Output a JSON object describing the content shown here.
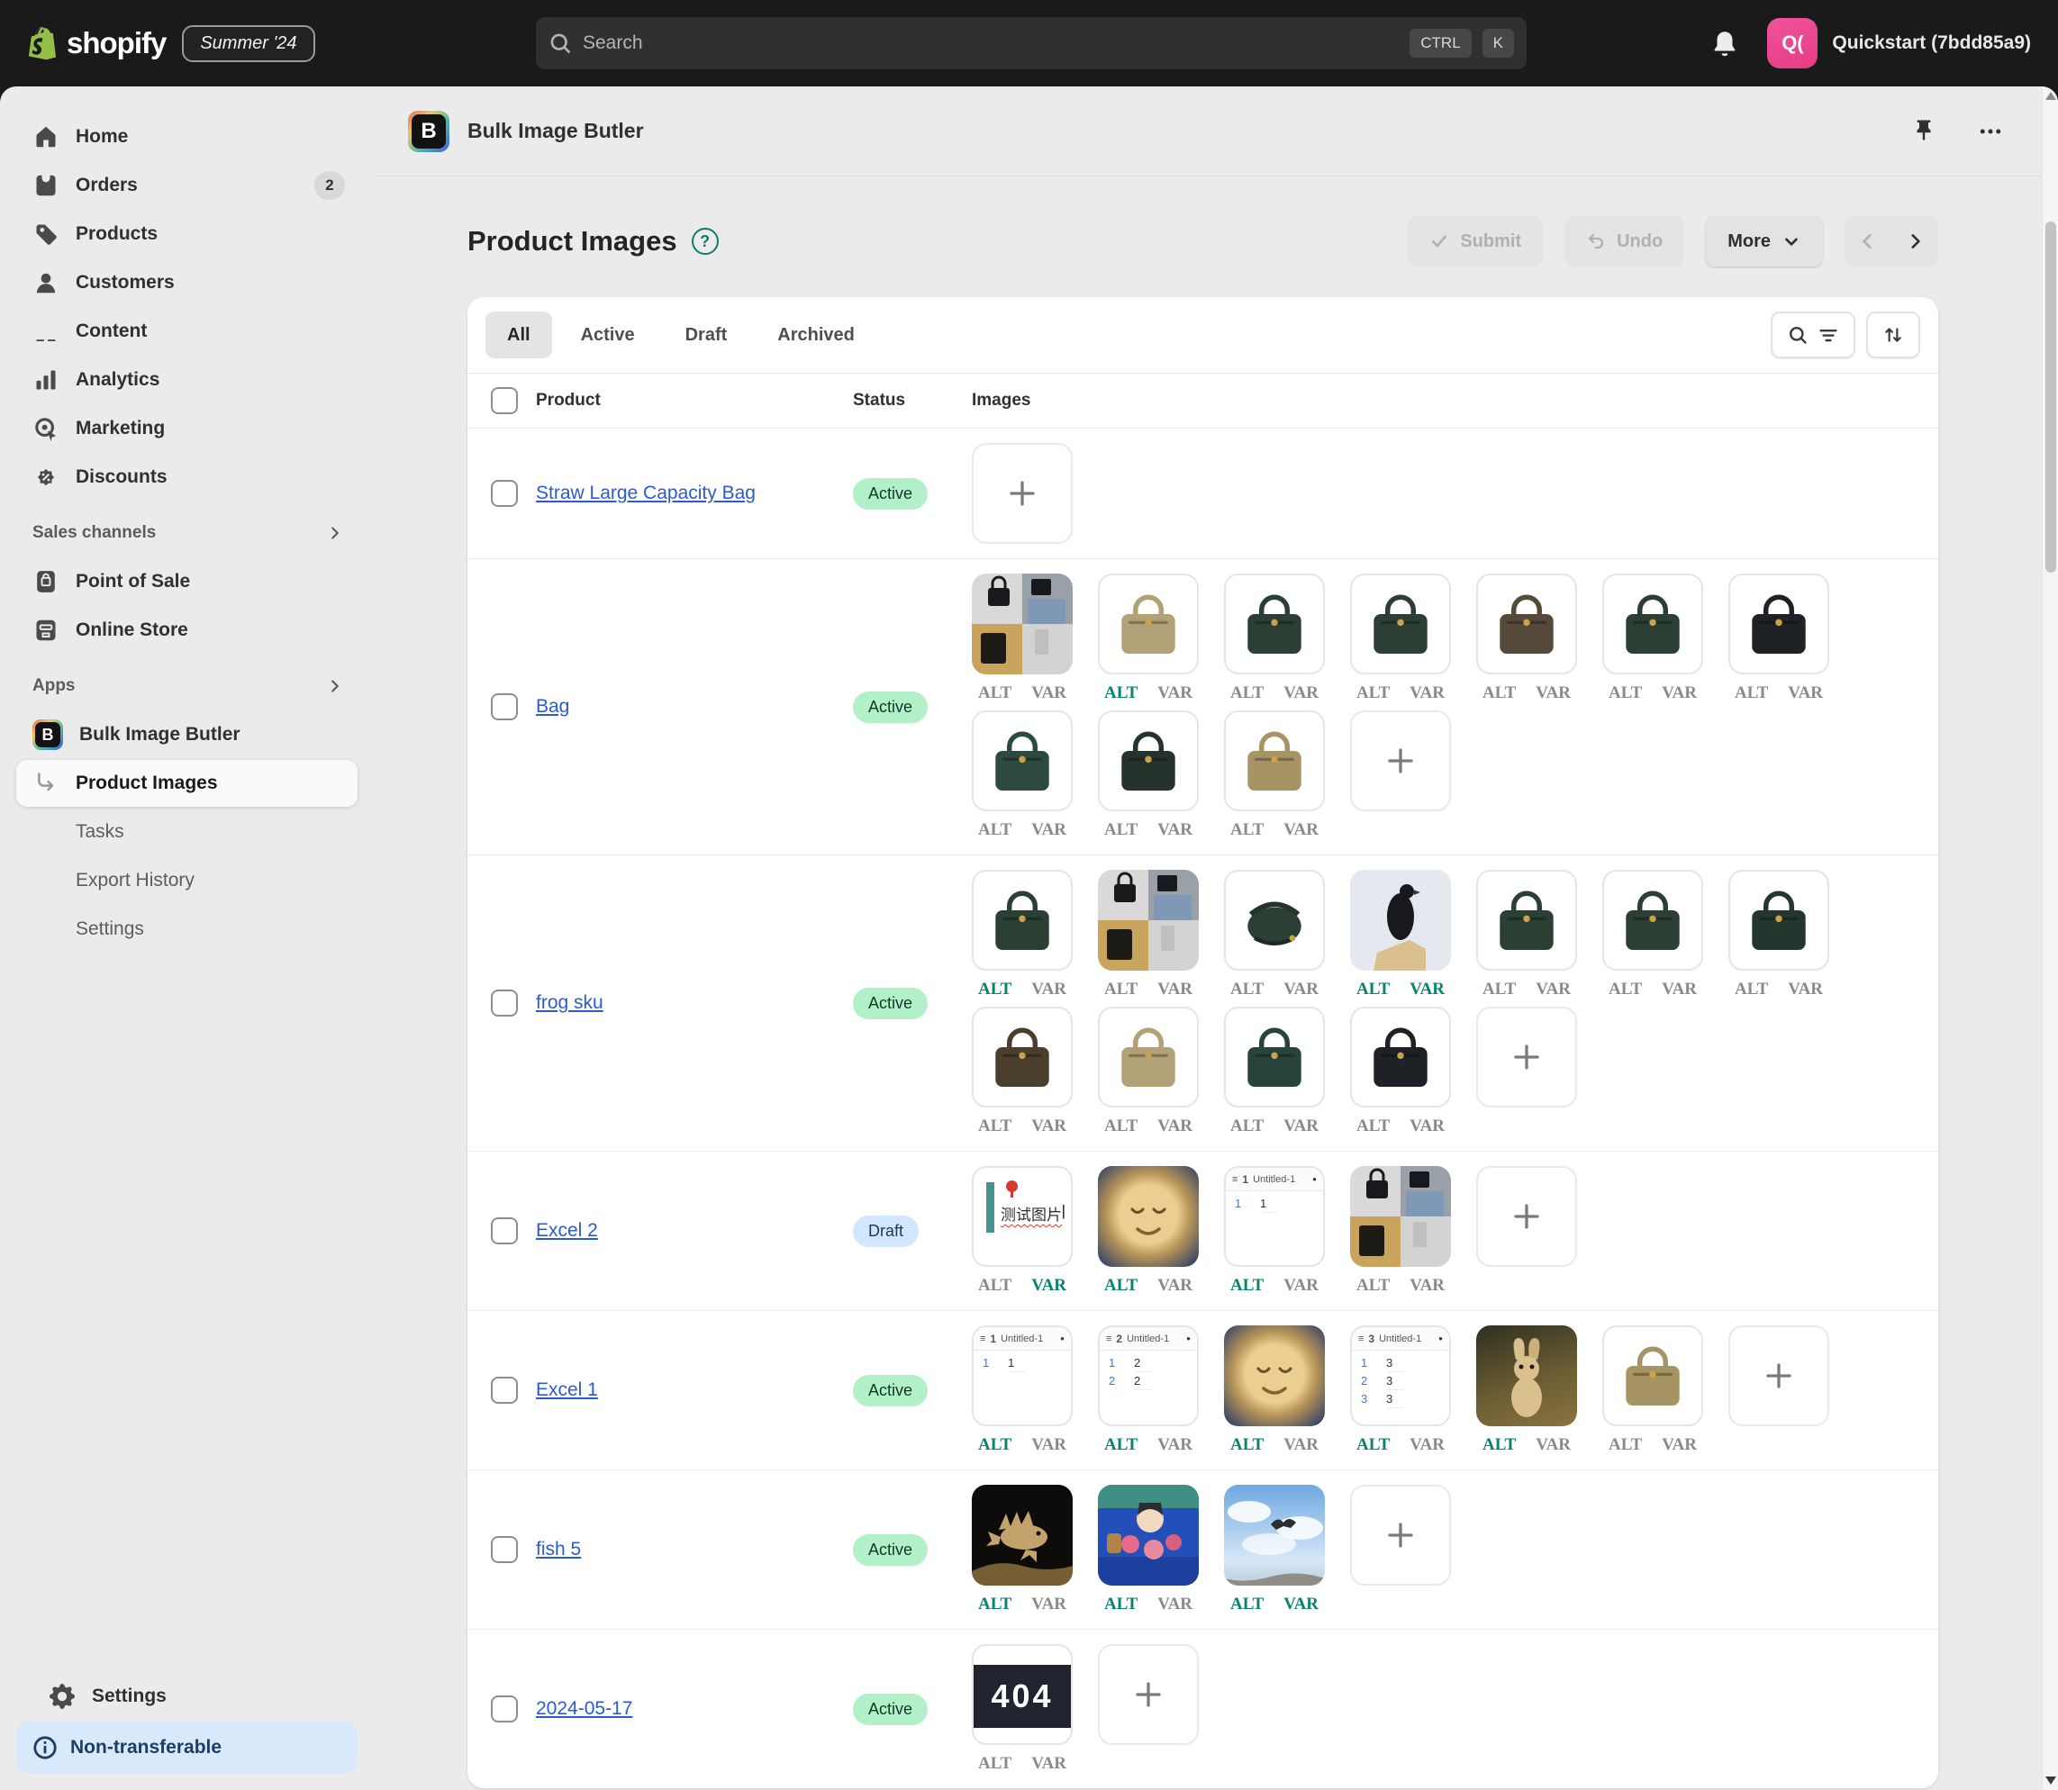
{
  "topbar": {
    "logo_text": "shopify",
    "version_badge": "Summer '24",
    "search_placeholder": "Search",
    "shortcut_keys": [
      "CTRL",
      "K"
    ],
    "user": {
      "initials": "Q(",
      "name": "Quickstart (7bdd85a9)"
    }
  },
  "sidebar": {
    "items": [
      {
        "label": "Home",
        "icon": "home"
      },
      {
        "label": "Orders",
        "icon": "orders",
        "badge": "2"
      },
      {
        "label": "Products",
        "icon": "tag"
      },
      {
        "label": "Customers",
        "icon": "person"
      },
      {
        "label": "Content",
        "icon": "picture"
      },
      {
        "label": "Analytics",
        "icon": "bars"
      },
      {
        "label": "Marketing",
        "icon": "target"
      },
      {
        "label": "Discounts",
        "icon": "discount"
      }
    ],
    "sections": [
      {
        "title": "Sales channels",
        "items": [
          {
            "label": "Point of Sale",
            "icon": "pos"
          },
          {
            "label": "Online Store",
            "icon": "store"
          }
        ]
      },
      {
        "title": "Apps",
        "items": [
          {
            "label": "Bulk Image Butler",
            "icon": "app-b"
          },
          {
            "label": "Product Images",
            "icon": "elbow",
            "active": true
          },
          {
            "label": "Tasks",
            "sub": true
          },
          {
            "label": "Export History",
            "sub": true
          },
          {
            "label": "Settings",
            "sub": true
          }
        ]
      }
    ],
    "footer": {
      "settings_label": "Settings",
      "notice": "Non-transferable"
    }
  },
  "app_header": {
    "title": "Bulk Image Butler",
    "icon_letter": "B"
  },
  "page": {
    "title": "Product Images",
    "help_glyph": "?",
    "submit_label": "Submit",
    "undo_label": "Undo",
    "more_label": "More"
  },
  "tabs": [
    {
      "label": "All",
      "active": true
    },
    {
      "label": "Active"
    },
    {
      "label": "Draft"
    },
    {
      "label": "Archived"
    }
  ],
  "table": {
    "columns": [
      "Product",
      "Status",
      "Images"
    ],
    "alt_label": "ALT",
    "var_label": "VAR",
    "sheet_title": "Untitled-1",
    "doc_text": "测试图片",
    "not_found_text": "404",
    "colors": {
      "label_active": "#0a8270",
      "label_inactive": "#8a8a8a",
      "link": "#2a5bd0",
      "badge_success_bg": "#b2f1c8",
      "badge_info_bg": "#d2e7fd"
    },
    "rows": [
      {
        "product": "Straw Large Capacity Bag",
        "status": "Active",
        "status_type": "success",
        "lines": [
          [
            {
              "kind": "add"
            }
          ]
        ]
      },
      {
        "product": "Bag",
        "status": "Active",
        "status_type": "success",
        "lines": [
          [
            {
              "kind": "collage",
              "alt": 0,
              "var": 0
            },
            {
              "kind": "bag",
              "color": "#b2a177",
              "alt": 1,
              "var": 0
            },
            {
              "kind": "bag",
              "color": "#2c3f35",
              "alt": 0,
              "var": 0
            },
            {
              "kind": "bag",
              "color": "#2c3f35",
              "alt": 0,
              "var": 0
            },
            {
              "kind": "bag",
              "color": "#55493a",
              "alt": 0,
              "var": 0
            },
            {
              "kind": "bag",
              "color": "#2c3f35",
              "alt": 0,
              "var": 0
            },
            {
              "kind": "bag",
              "color": "#1e2126",
              "alt": 0,
              "var": 0
            }
          ],
          [
            {
              "kind": "bag",
              "color": "#2c4a3e",
              "alt": 0,
              "var": 0
            },
            {
              "kind": "bag",
              "color": "#26332c",
              "alt": 0,
              "var": 0
            },
            {
              "kind": "bag",
              "color": "#a79464",
              "alt": 0,
              "var": 0
            },
            {
              "kind": "add"
            }
          ]
        ]
      },
      {
        "product": "frog sku",
        "status": "Active",
        "status_type": "success",
        "lines": [
          [
            {
              "kind": "bag",
              "color": "#2c3f35",
              "alt": 1,
              "var": 0
            },
            {
              "kind": "collage",
              "alt": 0,
              "var": 0
            },
            {
              "kind": "bagtop",
              "alt": 0,
              "var": 0
            },
            {
              "kind": "pigeon",
              "alt": 1,
              "var": 1
            },
            {
              "kind": "bag",
              "color": "#2c3f35",
              "alt": 0,
              "var": 0
            },
            {
              "kind": "bag",
              "color": "#2c3f35",
              "alt": 0,
              "var": 0
            },
            {
              "kind": "bag",
              "color": "#24372f",
              "alt": 0,
              "var": 0
            }
          ],
          [
            {
              "kind": "bag",
              "color": "#4a3e2d",
              "alt": 0,
              "var": 0
            },
            {
              "kind": "bag",
              "color": "#b2a177",
              "alt": 0,
              "var": 0
            },
            {
              "kind": "bag",
              "color": "#28443a",
              "alt": 0,
              "var": 0
            },
            {
              "kind": "bag",
              "color": "#1e2126",
              "alt": 0,
              "var": 0
            },
            {
              "kind": "add"
            }
          ]
        ]
      },
      {
        "product": "Excel 2",
        "status": "Draft",
        "status_type": "info",
        "lines": [
          [
            {
              "kind": "doczh",
              "alt": 0,
              "var": 1
            },
            {
              "kind": "face",
              "alt": 1,
              "var": 0
            },
            {
              "kind": "sheet",
              "num": "1",
              "alt": 1,
              "var": 0
            },
            {
              "kind": "collage",
              "alt": 0,
              "var": 0
            },
            {
              "kind": "add"
            }
          ]
        ]
      },
      {
        "product": "Excel 1",
        "status": "Active",
        "status_type": "success",
        "lines": [
          [
            {
              "kind": "sheet",
              "num": "1",
              "alt": 1,
              "var": 0
            },
            {
              "kind": "sheet",
              "num": "2",
              "alt": 1,
              "var": 0
            },
            {
              "kind": "face",
              "alt": 1,
              "var": 0
            },
            {
              "kind": "sheet",
              "num": "3",
              "alt": 1,
              "var": 0
            },
            {
              "kind": "rabbit",
              "alt": 1,
              "var": 0
            },
            {
              "kind": "bag",
              "color": "#a79464",
              "alt": 0,
              "var": 0
            },
            {
              "kind": "add"
            }
          ]
        ]
      },
      {
        "product": "fish 5",
        "status": "Active",
        "status_type": "success",
        "lines": [
          [
            {
              "kind": "lionfish",
              "alt": 1,
              "var": 0
            },
            {
              "kind": "aquarium",
              "alt": 1,
              "var": 0
            },
            {
              "kind": "seagull",
              "alt": 1,
              "var": 1
            },
            {
              "kind": "add"
            }
          ]
        ]
      },
      {
        "product": "2024-05-17",
        "status": "Active",
        "status_type": "success",
        "lines": [
          [
            {
              "kind": "n404",
              "alt": 0,
              "var": 0
            },
            {
              "kind": "add"
            }
          ]
        ]
      }
    ]
  }
}
